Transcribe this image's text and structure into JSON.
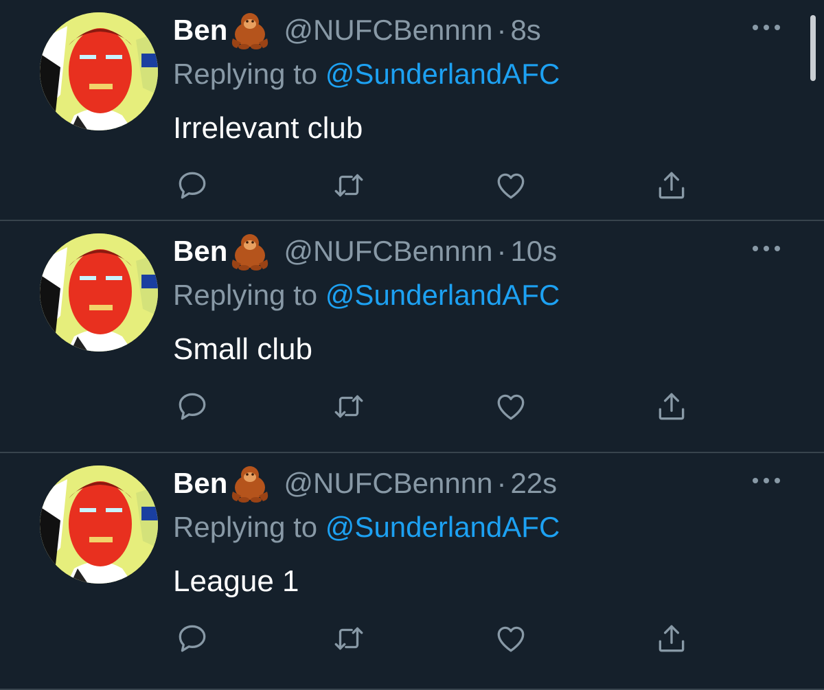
{
  "colors": {
    "background": "#15202b",
    "divider": "#38444d",
    "secondary_text": "#8899a6",
    "link": "#1da1f2",
    "primary_text": "#ffffff"
  },
  "icons": {
    "emoji": "orangutan-emoji",
    "reply": "reply-icon",
    "retweet": "retweet-icon",
    "like": "heart-icon",
    "share": "share-icon",
    "more": "more-options-icon"
  },
  "tweets": [
    {
      "name": "Ben",
      "handle": "@NUFCBennnn",
      "separator": "·",
      "time": "8s",
      "replying_prefix": "Replying to ",
      "replying_to": "@SunderlandAFC",
      "text": "Irrelevant club"
    },
    {
      "name": "Ben",
      "handle": "@NUFCBennnn",
      "separator": "·",
      "time": "10s",
      "replying_prefix": "Replying to ",
      "replying_to": "@SunderlandAFC",
      "text": "Small club"
    },
    {
      "name": "Ben",
      "handle": "@NUFCBennnn",
      "separator": "·",
      "time": "22s",
      "replying_prefix": "Replying to ",
      "replying_to": "@SunderlandAFC",
      "text": "League 1"
    }
  ]
}
